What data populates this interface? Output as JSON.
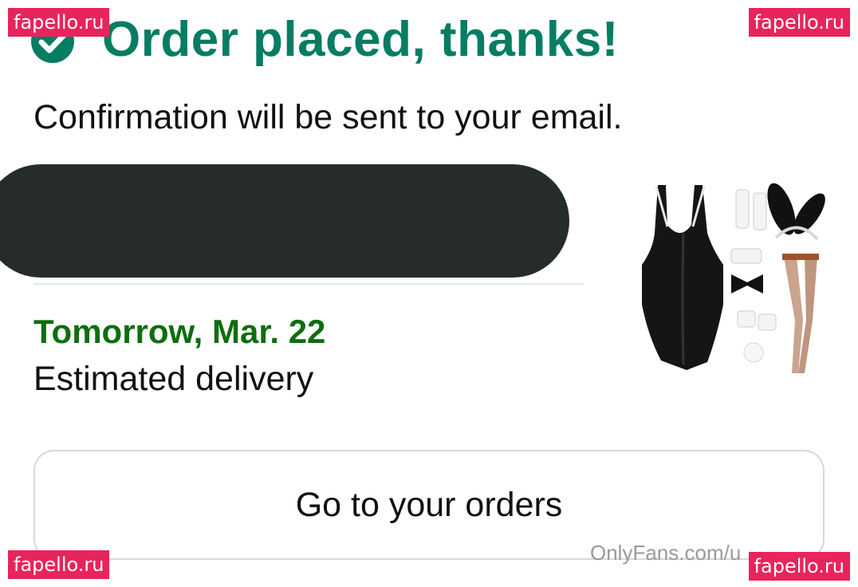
{
  "header": {
    "title": "Order placed, thanks!",
    "subtitle": "Confirmation will be sent to your email."
  },
  "delivery": {
    "date": "Tomorrow, Mar. 22",
    "label": "Estimated delivery"
  },
  "actions": {
    "orders_button": "Go to your orders"
  },
  "overlays": {
    "watermark": "fapello.ru",
    "source_text": "OnlyFans.com/u"
  },
  "colors": {
    "title_green": "#067d62",
    "date_green": "#0d6e0d",
    "redaction": "#262b2c",
    "watermark_bg": "#e8245c"
  },
  "icons": [
    "check-circle-icon"
  ]
}
